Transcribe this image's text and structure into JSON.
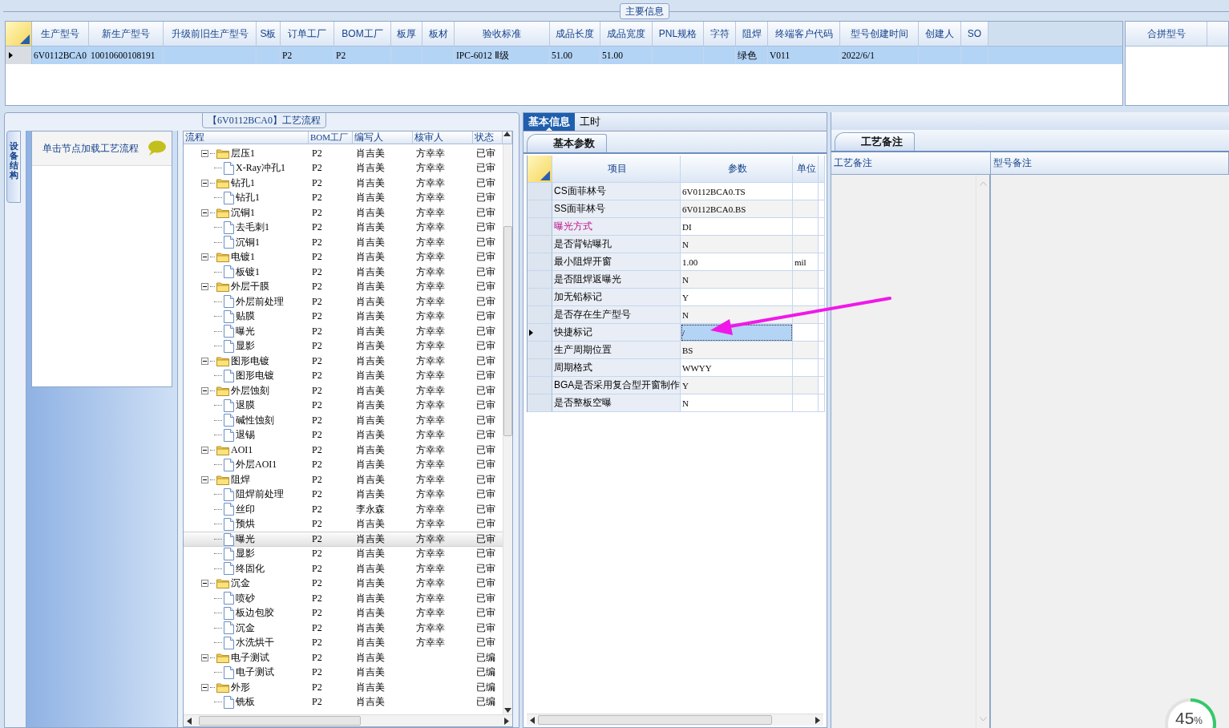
{
  "main_info": {
    "title": "主要信息",
    "columns": [
      "生产型号",
      "新生产型号",
      "升级前旧生产型号",
      "S板",
      "订单工厂",
      "BOM工厂",
      "板厚",
      "板材",
      "验收标准",
      "成品长度",
      "成品宽度",
      "PNL规格",
      "字符",
      "阻焊",
      "终端客户代码",
      "型号创建时间",
      "创建人",
      "SO"
    ],
    "rows": [
      {
        "current": true,
        "cells": [
          "6V0112BCA0",
          "10010600108191",
          null,
          null,
          "P2",
          "P2",
          null,
          null,
          "IPC-6012 Ⅱ级",
          "51.00",
          "51.00",
          null,
          null,
          "绿色",
          "V011",
          "2022/6/1",
          null,
          null
        ]
      }
    ]
  },
  "merge_panel": {
    "columns": [
      "合拼型号"
    ]
  },
  "process": {
    "title": "【6V0112BCA0】工艺流程",
    "side_tab": "设备结构",
    "side_hint": "单击节点加载工艺流程",
    "columns": [
      "流程",
      "BOM工厂",
      "编写人",
      "核审人",
      "状态"
    ],
    "tree": [
      {
        "name": "层压1",
        "bom": "P2",
        "writer": "肖吉美",
        "reviewer": "方幸幸",
        "status": "已审",
        "selected": false,
        "expanded": true,
        "children": [
          {
            "name": "X-Ray冲孔1",
            "bom": "P2",
            "writer": "肖吉美",
            "reviewer": "方幸幸",
            "status": "已审",
            "selected": false
          }
        ]
      },
      {
        "name": "钻孔1",
        "bom": "P2",
        "writer": "肖吉美",
        "reviewer": "方幸幸",
        "status": "已审",
        "selected": false,
        "expanded": true,
        "children": [
          {
            "name": "钻孔1",
            "bom": "P2",
            "writer": "肖吉美",
            "reviewer": "方幸幸",
            "status": "已审",
            "selected": false
          }
        ]
      },
      {
        "name": "沉铜1",
        "bom": "P2",
        "writer": "肖吉美",
        "reviewer": "方幸幸",
        "status": "已审",
        "selected": false,
        "expanded": true,
        "children": [
          {
            "name": "去毛刺1",
            "bom": "P2",
            "writer": "肖吉美",
            "reviewer": "方幸幸",
            "status": "已审",
            "selected": false
          },
          {
            "name": "沉铜1",
            "bom": "P2",
            "writer": "肖吉美",
            "reviewer": "方幸幸",
            "status": "已审",
            "selected": false
          }
        ]
      },
      {
        "name": "电镀1",
        "bom": "P2",
        "writer": "肖吉美",
        "reviewer": "方幸幸",
        "status": "已审",
        "selected": false,
        "expanded": true,
        "children": [
          {
            "name": "板镀1",
            "bom": "P2",
            "writer": "肖吉美",
            "reviewer": "方幸幸",
            "status": "已审",
            "selected": false
          }
        ]
      },
      {
        "name": "外层干膜",
        "bom": "P2",
        "writer": "肖吉美",
        "reviewer": "方幸幸",
        "status": "已审",
        "selected": false,
        "expanded": true,
        "children": [
          {
            "name": "外层前处理",
            "bom": "P2",
            "writer": "肖吉美",
            "reviewer": "方幸幸",
            "status": "已审",
            "selected": false
          },
          {
            "name": "贴膜",
            "bom": "P2",
            "writer": "肖吉美",
            "reviewer": "方幸幸",
            "status": "已审",
            "selected": false
          },
          {
            "name": "曝光",
            "bom": "P2",
            "writer": "肖吉美",
            "reviewer": "方幸幸",
            "status": "已审",
            "selected": false
          },
          {
            "name": "显影",
            "bom": "P2",
            "writer": "肖吉美",
            "reviewer": "方幸幸",
            "status": "已审",
            "selected": false
          }
        ]
      },
      {
        "name": "图形电镀",
        "bom": "P2",
        "writer": "肖吉美",
        "reviewer": "方幸幸",
        "status": "已审",
        "selected": false,
        "expanded": true,
        "children": [
          {
            "name": "图形电镀",
            "bom": "P2",
            "writer": "肖吉美",
            "reviewer": "方幸幸",
            "status": "已审",
            "selected": false
          }
        ]
      },
      {
        "name": "外层蚀刻",
        "bom": "P2",
        "writer": "肖吉美",
        "reviewer": "方幸幸",
        "status": "已审",
        "selected": false,
        "expanded": true,
        "children": [
          {
            "name": "退膜",
            "bom": "P2",
            "writer": "肖吉美",
            "reviewer": "方幸幸",
            "status": "已审",
            "selected": false
          },
          {
            "name": "碱性蚀刻",
            "bom": "P2",
            "writer": "肖吉美",
            "reviewer": "方幸幸",
            "status": "已审",
            "selected": false
          },
          {
            "name": "退锡",
            "bom": "P2",
            "writer": "肖吉美",
            "reviewer": "方幸幸",
            "status": "已审",
            "selected": false
          }
        ]
      },
      {
        "name": "AOI1",
        "bom": "P2",
        "writer": "肖吉美",
        "reviewer": "方幸幸",
        "status": "已审",
        "selected": false,
        "expanded": true,
        "children": [
          {
            "name": "外层AOI1",
            "bom": "P2",
            "writer": "肖吉美",
            "reviewer": "方幸幸",
            "status": "已审",
            "selected": false
          }
        ]
      },
      {
        "name": "阻焊",
        "bom": "P2",
        "writer": "肖吉美",
        "reviewer": "方幸幸",
        "status": "已审",
        "selected": false,
        "expanded": true,
        "children": [
          {
            "name": "阻焊前处理",
            "bom": "P2",
            "writer": "肖吉美",
            "reviewer": "方幸幸",
            "status": "已审",
            "selected": false
          },
          {
            "name": "丝印",
            "bom": "P2",
            "writer": "李永森",
            "reviewer": "方幸幸",
            "status": "已审",
            "selected": false
          },
          {
            "name": "预烘",
            "bom": "P2",
            "writer": "肖吉美",
            "reviewer": "方幸幸",
            "status": "已审",
            "selected": false
          },
          {
            "name": "曝光",
            "bom": "P2",
            "writer": "肖吉美",
            "reviewer": "方幸幸",
            "status": "已审",
            "selected": true
          },
          {
            "name": "显影",
            "bom": "P2",
            "writer": "肖吉美",
            "reviewer": "方幸幸",
            "status": "已审",
            "selected": false
          },
          {
            "name": "终固化",
            "bom": "P2",
            "writer": "肖吉美",
            "reviewer": "方幸幸",
            "status": "已审",
            "selected": false
          }
        ]
      },
      {
        "name": "沉金",
        "bom": "P2",
        "writer": "肖吉美",
        "reviewer": "方幸幸",
        "status": "已审",
        "selected": false,
        "expanded": true,
        "children": [
          {
            "name": "喷砂",
            "bom": "P2",
            "writer": "肖吉美",
            "reviewer": "方幸幸",
            "status": "已审",
            "selected": false
          },
          {
            "name": "板边包胶",
            "bom": "P2",
            "writer": "肖吉美",
            "reviewer": "方幸幸",
            "status": "已审",
            "selected": false
          },
          {
            "name": "沉金",
            "bom": "P2",
            "writer": "肖吉美",
            "reviewer": "方幸幸",
            "status": "已审",
            "selected": false
          },
          {
            "name": "水洗烘干",
            "bom": "P2",
            "writer": "肖吉美",
            "reviewer": "方幸幸",
            "status": "已审",
            "selected": false
          }
        ]
      },
      {
        "name": "电子测试",
        "bom": "P2",
        "writer": "肖吉美",
        "status": "已编",
        "selected": false,
        "expanded": true,
        "children": [
          {
            "name": "电子测试",
            "bom": "P2",
            "writer": "肖吉美",
            "status": "已编",
            "selected": false
          }
        ]
      },
      {
        "name": "外形",
        "bom": "P2",
        "writer": "肖吉美",
        "status": "已编",
        "selected": false,
        "expanded": true,
        "children": [
          {
            "name": "铣板",
            "bom": "P2",
            "writer": "肖吉美",
            "status": "已编",
            "selected": false
          }
        ]
      }
    ]
  },
  "info_tabs": [
    {
      "label": "基本信息",
      "selected": true
    },
    {
      "label": "工时",
      "selected": false
    }
  ],
  "param_tab": "基本参数",
  "params": {
    "columns": [
      "项目",
      "参数",
      "单位"
    ],
    "rows": [
      {
        "item": "CS面菲林号",
        "value": "6V0112BCA0.TS",
        "highlighted": false,
        "current": false
      },
      {
        "item": "SS面菲林号",
        "value": "6V0112BCA0.BS",
        "highlighted": false,
        "current": false
      },
      {
        "item": "曝光方式",
        "value": "DI",
        "highlighted": true,
        "current": false
      },
      {
        "item": "是否背钻曝孔",
        "value": "N",
        "highlighted": false,
        "current": false
      },
      {
        "item": "最小阻焊开窗",
        "value": "1.00",
        "unit": "mil",
        "highlighted": false,
        "current": false
      },
      {
        "item": "是否阻焊返曝光",
        "value": "N",
        "highlighted": false,
        "current": false
      },
      {
        "item": "加无铅标记",
        "value": "Y",
        "highlighted": false,
        "current": false
      },
      {
        "item": "是否存在生产型号",
        "value": "N",
        "highlighted": false,
        "current": false
      },
      {
        "item": "快捷标记",
        "value": "/",
        "highlighted": false,
        "current": true
      },
      {
        "item": "生产周期位置",
        "value": "BS",
        "highlighted": false,
        "current": false
      },
      {
        "item": "周期格式",
        "value": "WWYY",
        "highlighted": false,
        "current": false
      },
      {
        "item": "BGA是否采用复合型开窗制作",
        "value": "Y",
        "highlighted": false,
        "current": false
      },
      {
        "item": "是否整板空曝",
        "value": "N",
        "highlighted": false,
        "current": false
      }
    ]
  },
  "notes_tab": "工艺备注",
  "notes_columns": [
    "工艺备注",
    "型号备注"
  ],
  "progress_badge": {
    "value": "45",
    "unit": "%",
    "level": 0.45
  }
}
